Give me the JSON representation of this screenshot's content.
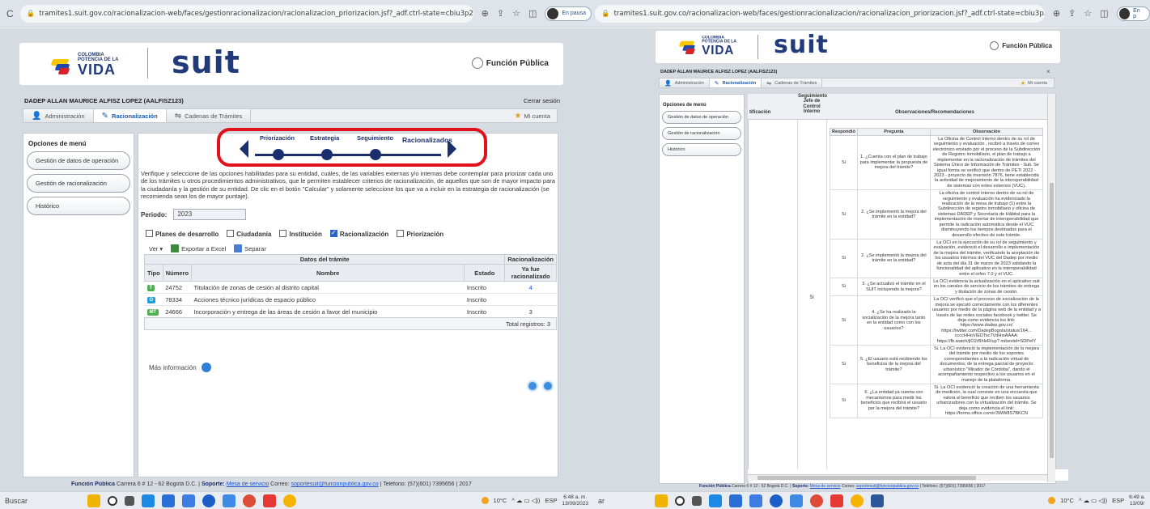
{
  "left": {
    "browser": {
      "url": "tramites1.suit.gov.co/racionalizacion-web/faces/gestionracionalizacion/racionalizacion_priorizacion.jsf?_adf.ctrl-state=cbiu3p2ry_3",
      "profile_status": "En pausa"
    },
    "header": {
      "colombia_small": "COLOMBIA\nPOTENCIA DE LA",
      "colombia_big": "VIDA",
      "suit": "suit",
      "funcion_publica": "Función Pública"
    },
    "user_line": "DADEP ALLAN MAURICE ALFISZ LOPEZ (AALFISZ123)",
    "logout": "Cerrar sesión",
    "tabs": [
      {
        "label": "Administración"
      },
      {
        "label": "Racionalización"
      },
      {
        "label": "Cadenas de Trámites"
      }
    ],
    "mi_cuenta": "Mi cuenta",
    "menu": {
      "title": "Opciones de menú",
      "items": [
        "Gestión de datos de operación",
        "Gestión de racionalización",
        "Histórico"
      ]
    },
    "wizard_steps": [
      "Priorización",
      "Estrategia",
      "Seguimiento",
      "Racionalizados"
    ],
    "instructions": "Verifique y seleccione de las opciones habilitadas para su entidad, cuáles, de las variables externas y/o internas debe contemplar para priorizar cada uno de los trámites u otros procedimientos administrativos, que le permiten establecer criterios de racionalización, de aquellos que son de mayor impacto para la ciudadanía y la gestión de su entidad. De clic en el botón \"Calcular\" y solamente seleccione los que va a incluir en la estrategia de racionalización (se recomienda sean los de mayor puntaje).",
    "periodo_label": "Periodo:",
    "periodo_value": "2023",
    "checkboxes": [
      {
        "label": "Planes de desarrollo",
        "checked": false
      },
      {
        "label": "Ciudadanía",
        "checked": false
      },
      {
        "label": "Institución",
        "checked": false
      },
      {
        "label": "Racionalización",
        "checked": true
      },
      {
        "label": "Priorización",
        "checked": false
      }
    ],
    "toolbar": {
      "ver": "Ver ▾",
      "exportar": "Exportar a Excel",
      "separar": "Separar"
    },
    "table": {
      "group1": "Datos del trámite",
      "group2": "Racionalización",
      "headers": [
        "Tipo",
        "Número",
        "Nombre",
        "Estado",
        "Ya fue racionalizado"
      ],
      "rows": [
        {
          "tipo": "T",
          "tipo_color": "#4caf50",
          "numero": "24752",
          "nombre": "Titulación de zonas de cesión al distrito capital",
          "estado": "Inscrito",
          "ya": "4"
        },
        {
          "tipo": "O",
          "tipo_color": "#1f9fd9",
          "numero": "78334",
          "nombre": "Acciones técnico jurídicas de espacio público",
          "estado": "Inscrito",
          "ya": ""
        },
        {
          "tipo": "MT",
          "tipo_color": "#4caf50",
          "numero": "24666",
          "nombre": "Incorporación y entrega de las áreas de cesión a favor del municipio",
          "estado": "Inscrito",
          "ya": "3"
        }
      ],
      "total": "Total registros: 3"
    },
    "mas_info": "Más información",
    "footer": {
      "org": "Función Pública",
      "addr": "Carrera 6 # 12 - 62 Bogotá D.C. |",
      "soporte": "Soporte:",
      "mesa": "Mesa de servicio",
      "correo": "Correo:",
      "mail": "soportesuit@funcionpublica.gov.co",
      "tel": "| Teléfono: (57)(601) 7395656 | 2017"
    },
    "taskbar": {
      "search": "Buscar",
      "weather": "10°C",
      "lang": "ESP",
      "time": "6:48 a. m.",
      "date": "13/09/2023"
    }
  },
  "right": {
    "browser": {
      "url": "tramites1.suit.gov.co/racionalizacion-web/faces/gestionracionalizacion/racionalizacion_priorizacion.jsf?_adf.ctrl-state=cbiu3p2ry_3",
      "profile_status": "En p"
    },
    "user_line": "DADEP ALLAN MAURICE ALFISZ LOPEZ (AALFISZ123)",
    "close_x": "×",
    "tabs": [
      "Administración",
      "Racionalización",
      "Cadenas de Trámites"
    ],
    "mi_cuenta": "Mi cuenta",
    "menu": {
      "title": "Opciones de menú",
      "items": [
        "Gestión de datos de operación",
        "Gestión de racionalización",
        "Histórico"
      ]
    },
    "col_head_ticacion": "tificación",
    "col_head_seguimiento": "Seguimiento\nJefe de\nControl\nInterno",
    "col_head_obs": "Observaciones/Recomendaciones",
    "inner_headers": [
      "Respondió",
      "Pregunta",
      "Observación"
    ],
    "outer_si": "Si",
    "rows": [
      {
        "resp": "Si",
        "preg": "1. ¿Cuenta con el plan de trabajo para implementar la propuesta de mejora del trámite?",
        "obs": "La Oficina de Control Interno dentro de su rol de seguimiento y evaluación , recibió a través de correo electrónico enviado por el proceso de la Subdirección de Registro Inmobiliario, el plan de trabajo a implementar en la racionalización de trámites del Sistema Único de Información de Trámites - Suit. Se igual forma se verificó que dentro de PETI 2022 - 2023 - proyecto de inversión 7876, tiene establecida la actividad de mejoramiento de la interoperabilidad de sistemas con entes externos (VUC)."
      },
      {
        "resp": "Si",
        "preg": "2. ¿Se implementó la mejora del trámite en la entidad?",
        "obs": "La oficina de control interno dentro de su rol de seguimiento y evaluación ha evidenciado la realización de la mesa de trabajo (1) entre la Subdirección de registro inmobiliario y oficina de sistemas DADEP y Secretaría de Hábitat para la implementación de insertar de interoperabilidad que permite la radicación automática desde el VUC disminuyendo los tiempos destinados para el desarrollo efectivo de este trámite."
      },
      {
        "resp": "Si",
        "preg": "2. ¿Se implementó la mejora del trámite en la entidad?",
        "obs": "La OCI en la ejecución de su rol de seguimiento y evaluación, evidenció el desarrollo e implementación de la mejora del trámite, verificando la aceptación de los usuarios internos del VUC del Dadep por medio de acta del día 31 de marzo de 2023 validando la funcionalidad del aplicativo en la interoperabilidad entre el orfeo 7.0 y el VUC."
      },
      {
        "resp": "Si",
        "preg": "3. ¿Se actualizó el trámite en el SUIT incluyendo la mejora?",
        "obs": "La OCI evidencia la actualización en el aplicativo suit en los canales de servicio de los trámites de entrega y titulación de zonas de cesión."
      },
      {
        "resp": "Si",
        "preg": "4. ¿Se ha realizado la socialización de la mejora tanto en la entidad como con los usuarios?",
        "obs": "La OCI verificó que el proceso de socialización de la mejora se ejecutó correctamente con los diferentes usuarios por medio de la página web de la entidad y a través de las redes sociales facebook y twitter. Se deja como evidencia los link: https://www.dadep.gov.co/ https://twitter.com/DadepBogota/status/164... ccccHHoVIEDTsc7VdHioAAAA: https://fb.watch/jlO2rBhleR/up? mibextid=SDPelY"
      },
      {
        "resp": "Si",
        "preg": "5. ¿El usuario está recibiendo los beneficios de la mejora del trámite?",
        "obs": "Si. La OCI evidenció la implementación de la mejora del trámite por medio de los soportes correspondientes a la radicación virtual de documentos; de la entrega parcial de proyecto urbanístico \"Mirador de Córdoba\", dando el acompañamiento respectivo a los usuarios en el manejo de la plataforma."
      },
      {
        "resp": "Si",
        "preg": "6. ¿La entidad ya cuenta con mecanismos para medir los beneficios que recibirá el usuario por la mejora del trámite?",
        "obs": "Si. La OCI evidenció la creación de una herramienta de medición, la cual consiste en una encuesta que valora el beneficio que reciben los usuarios urbanizadores con la virtualización del trámite. Se deja como evidencia el link: https://forms.office.com/r/3WW8S7BKCN"
      }
    ],
    "footer": {
      "org": "Función Pública",
      "addr": "Carrera 6 # 12 - 62 Bogotá D.C. |",
      "soporte": "Soporte:",
      "mesa": "Mesa de servicio",
      "correo": "Correo:",
      "mail": "soportesuit@funcionpublica.gov.co",
      "tel": "| Teléfono: (57)(601) 7395656 | 2017"
    },
    "taskbar": {
      "search": "ar",
      "weather": "10°C",
      "lang": "ESP",
      "time": "6:49 a.",
      "date": "13/09/"
    }
  }
}
